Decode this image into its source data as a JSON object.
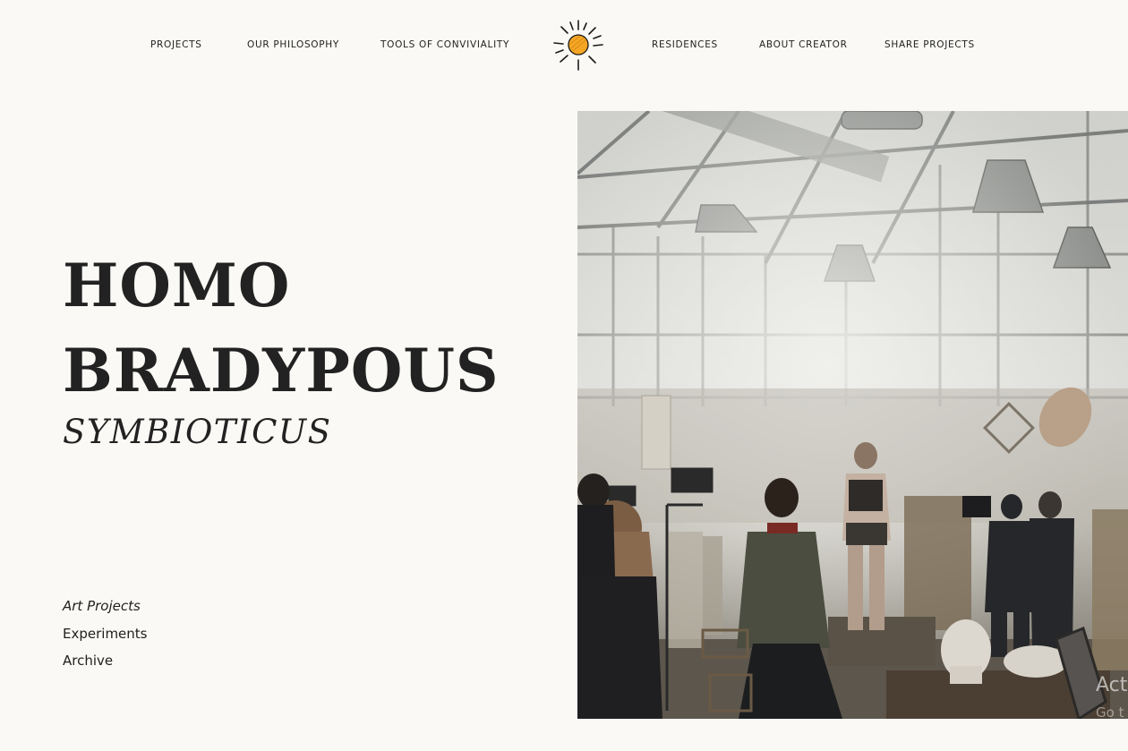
{
  "nav": {
    "left": [
      "PROJECTS",
      "OUR PHILOSOPHY",
      "TOOLS OF CONVIVIALITY"
    ],
    "right": [
      "RESIDENCES",
      "ABOUT CREATOR",
      "SHARE PROJECTS"
    ],
    "logo_icon": "sun-icon",
    "logo_color": "#f5a623"
  },
  "hero": {
    "title_line1": "HOMO",
    "title_line2": "BRADYPOUS",
    "subtitle": "SYMBIOTICUS"
  },
  "side_links": {
    "items": [
      "Art Projects",
      "Experiments",
      "Archive"
    ],
    "active": "Art Projects"
  },
  "photo": {
    "description_icon": "studio-photo",
    "watermark_line1": "Act",
    "watermark_line2": "Go t"
  },
  "colors": {
    "background": "#faf9f5",
    "text": "#1f1f1f"
  }
}
